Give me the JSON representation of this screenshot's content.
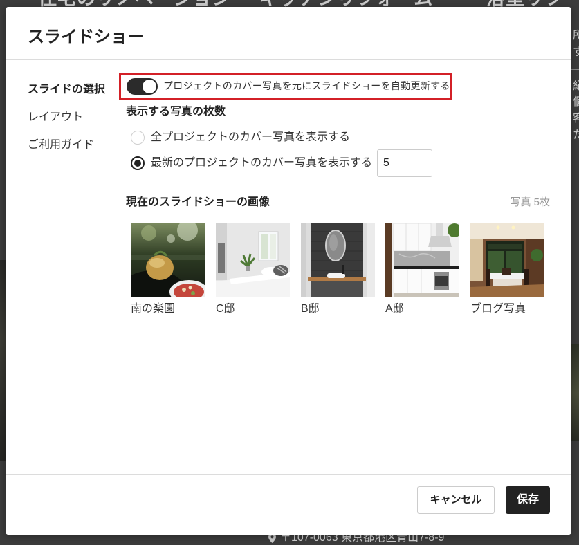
{
  "background": {
    "nav_items": [
      "住宅のリノベーション",
      "キッチンリフォーム",
      "浴室リフ"
    ],
    "right_fragments": [
      "所",
      "す",
      "紀",
      "個",
      "客",
      "た"
    ],
    "address": "〒107-0063 東京都港区青山7-8-9"
  },
  "modal": {
    "title": "スライドショー",
    "sidebar": {
      "items": [
        {
          "label": "スライドの選択",
          "active": true
        },
        {
          "label": "レイアウト",
          "active": false
        },
        {
          "label": "ご利用ガイド",
          "active": false
        }
      ]
    },
    "auto_update": {
      "enabled": true,
      "label": "プロジェクトのカバー写真を元にスライドショーを自動更新する"
    },
    "photo_count": {
      "heading": "表示する写真の枚数",
      "options": [
        {
          "label": "全プロジェクトのカバー写真を表示する",
          "checked": false
        },
        {
          "label": "最新のプロジェクトのカバー写真を表示する",
          "checked": true
        }
      ],
      "latest_count_value": "5"
    },
    "current_images": {
      "heading": "現在のスライドショーの画像",
      "count_label": "写真 5枚",
      "items": [
        {
          "label": "南の楽園"
        },
        {
          "label": "C邸"
        },
        {
          "label": "B邸"
        },
        {
          "label": "A邸"
        },
        {
          "label": "ブログ写真"
        }
      ]
    },
    "footer": {
      "cancel_label": "キャンセル",
      "save_label": "保存"
    }
  },
  "icons": {
    "address": "map-pin-icon"
  },
  "colors": {
    "backdrop": "#3c3c3c",
    "text_dark": "#222222",
    "highlight_red": "#d32027",
    "muted_text": "#999999",
    "button_dark": "#222222",
    "border": "#cccccc"
  }
}
